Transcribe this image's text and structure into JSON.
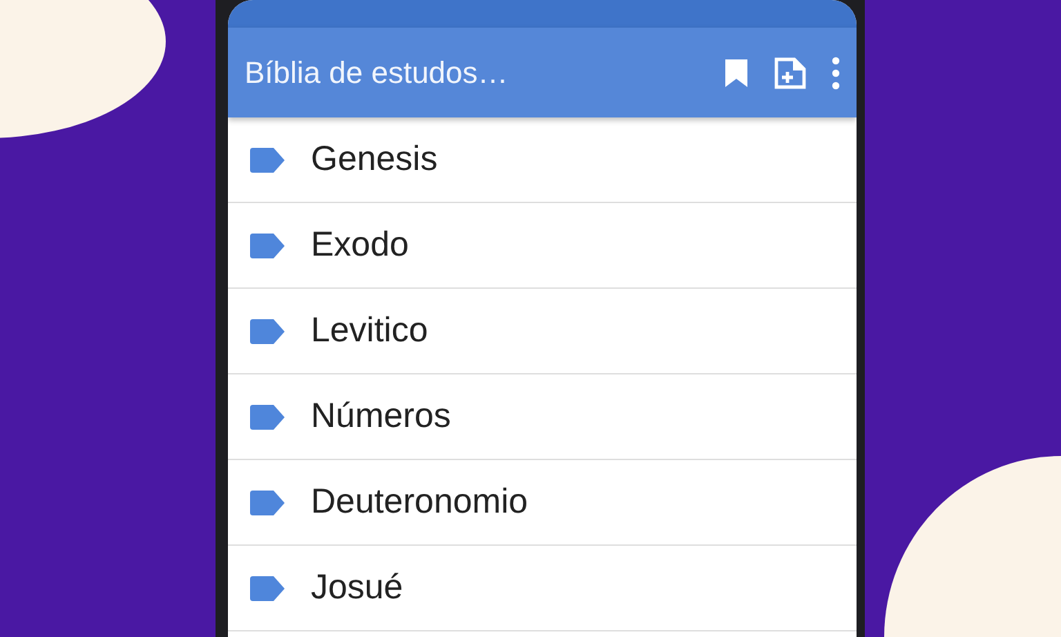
{
  "app_bar": {
    "title": "Bíblia de estudos…"
  },
  "books": [
    {
      "name": "Genesis"
    },
    {
      "name": "Exodo"
    },
    {
      "name": "Levitico"
    },
    {
      "name": "Números"
    },
    {
      "name": "Deuteronomio"
    },
    {
      "name": "Josué"
    }
  ]
}
